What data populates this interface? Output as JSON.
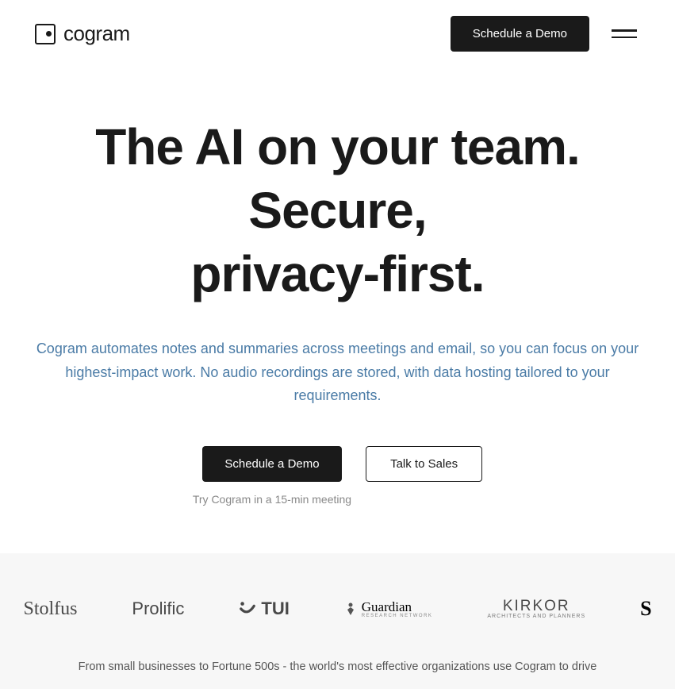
{
  "header": {
    "logo_text": "cogram",
    "cta_label": "Schedule a Demo"
  },
  "hero": {
    "title_line1": "The AI on your team.",
    "title_line2": "Secure,",
    "title_line3": "privacy-first.",
    "subtitle": "Cogram automates notes and summaries across meetings and email, so you can focus on your highest-impact work. No audio recordings are stored, with data hosting tailored to your requirements.",
    "primary_cta": "Schedule a Demo",
    "primary_helper": "Try Cogram in a 15-min meeting",
    "secondary_cta": "Talk to Sales"
  },
  "clients": {
    "logos": [
      "Stolfus",
      "Prolific",
      "TUI",
      "Guardian",
      "RESEARCH NETWORK",
      "KIRKOR",
      "ARCHITECTS AND PLANNERS",
      "S"
    ]
  },
  "social_proof": {
    "text": "From small businesses to Fortune 500s - the world's most effective organizations use Cogram to drive"
  }
}
